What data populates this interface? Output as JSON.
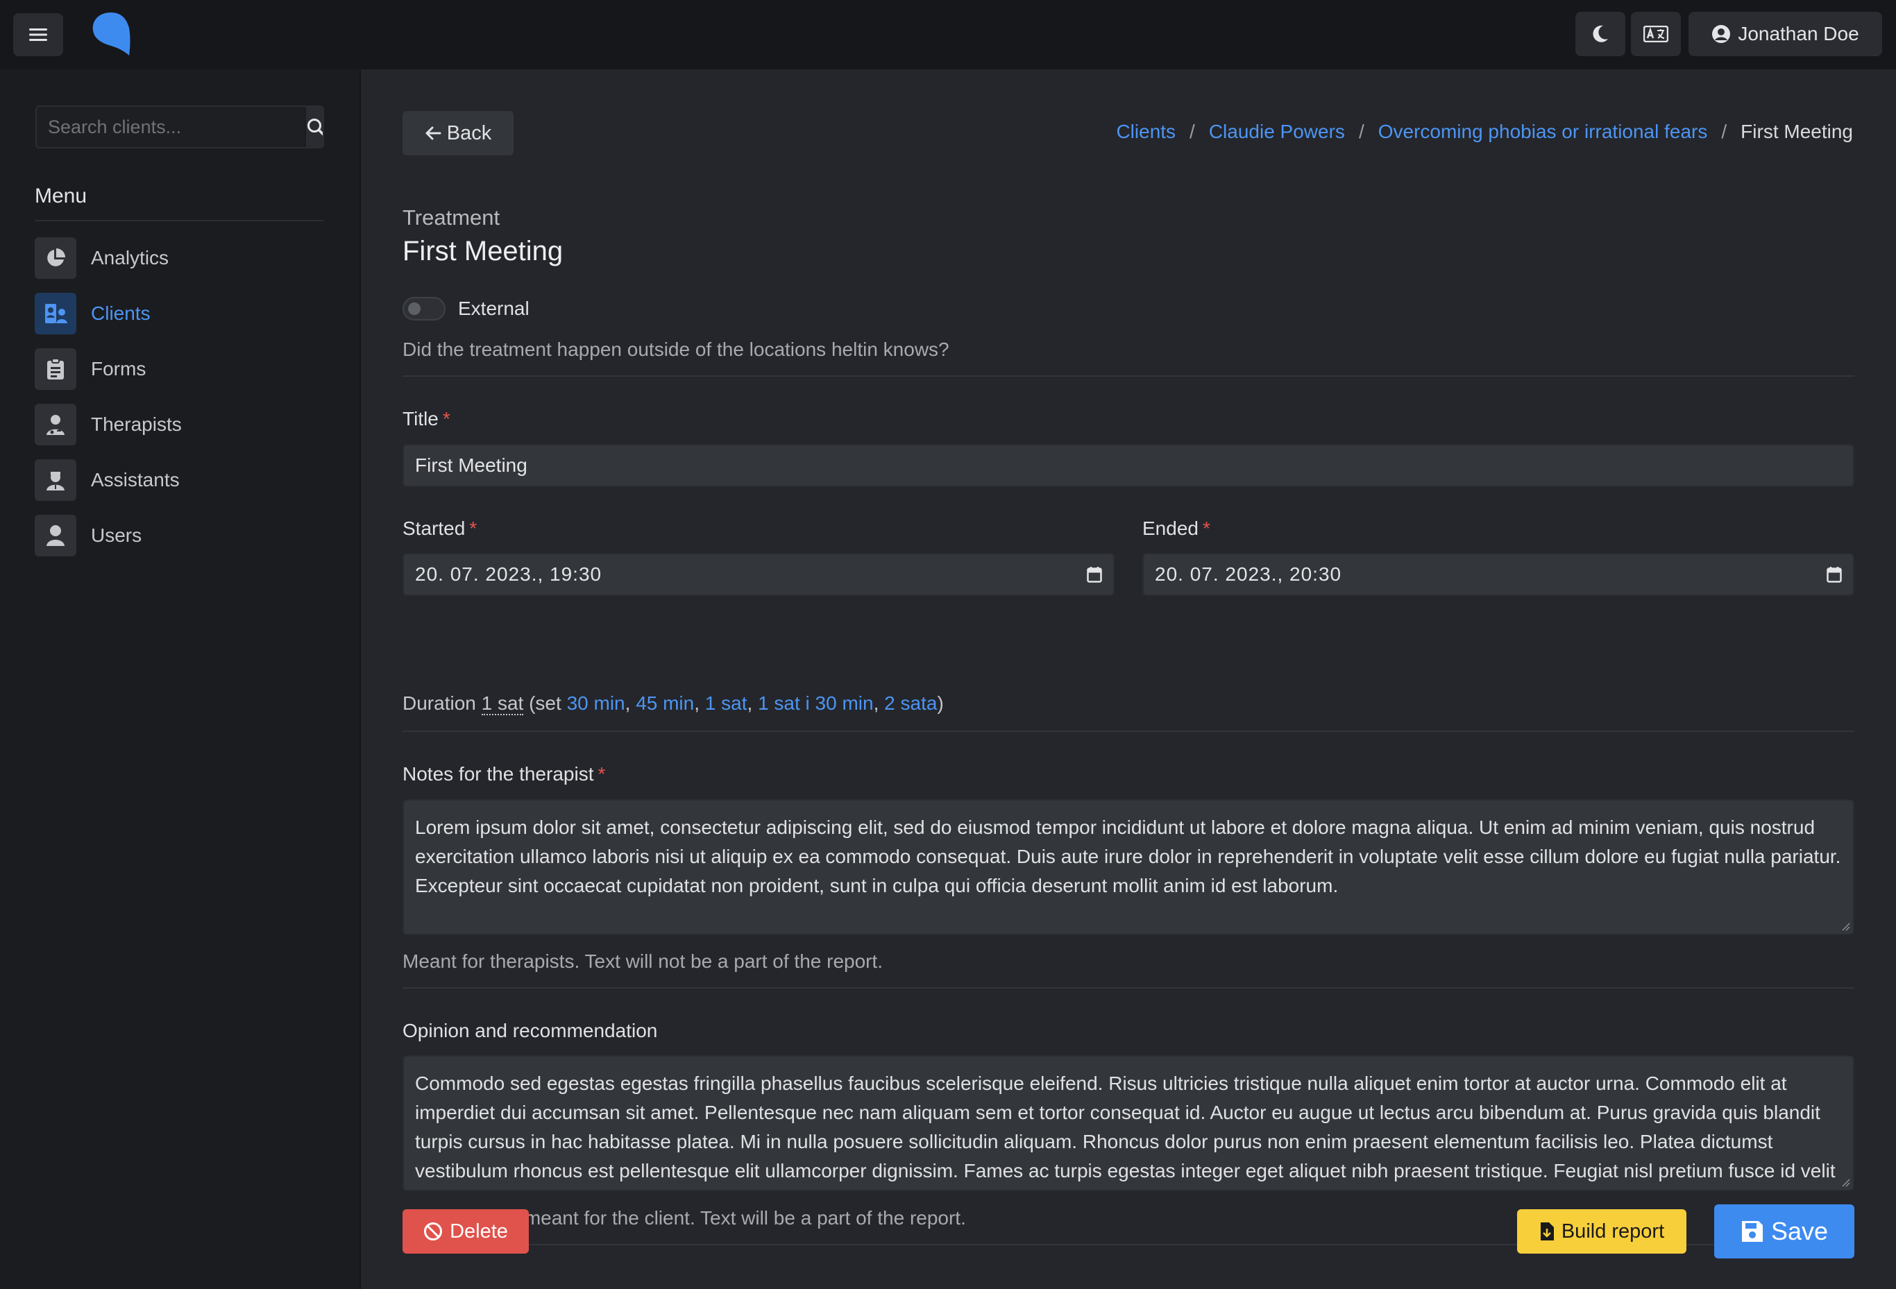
{
  "header": {
    "user_name": "Jonathan Doe"
  },
  "sidebar": {
    "search_placeholder": "Search clients...",
    "menu_title": "Menu",
    "items": [
      {
        "label": "Analytics",
        "icon": "chart-pie-icon"
      },
      {
        "label": "Clients",
        "icon": "clients-icon",
        "active": true
      },
      {
        "label": "Forms",
        "icon": "clipboard-icon"
      },
      {
        "label": "Therapists",
        "icon": "therapist-icon"
      },
      {
        "label": "Assistants",
        "icon": "assistant-icon"
      },
      {
        "label": "Users",
        "icon": "user-icon"
      }
    ]
  },
  "main": {
    "back_label": "Back",
    "breadcrumb": {
      "clients": "Clients",
      "client": "Claudie Powers",
      "treatment_plan": "Overcoming phobias or irrational fears",
      "current": "First Meeting",
      "separator": "/"
    },
    "eyebrow": "Treatment",
    "title": "First Meeting",
    "external": {
      "label": "External",
      "checked": false,
      "help": "Did the treatment happen outside of the locations heltin knows?"
    },
    "title_field": {
      "label": "Title",
      "required_mark": "*",
      "value": "First Meeting"
    },
    "started": {
      "label": "Started",
      "required_mark": "*",
      "value": "20. 07. 2023., 19:30"
    },
    "ended": {
      "label": "Ended",
      "required_mark": "*",
      "value": "20. 07. 2023., 20:30"
    },
    "duration": {
      "label": "Duration",
      "value": "1 sat",
      "set_prefix": "(set",
      "options": [
        "30 min",
        "45 min",
        "1 sat",
        "1 sat i 30 min",
        "2 sata"
      ],
      "close": ")"
    },
    "notes": {
      "label": "Notes for the therapist",
      "required_mark": "*",
      "value": "Lorem ipsum dolor sit amet, consectetur adipiscing elit, sed do eiusmod tempor incididunt ut labore et dolore magna aliqua. Ut enim ad minim veniam, quis nostrud exercitation ullamco laboris nisi ut aliquip ex ea commodo consequat. Duis aute irure dolor in reprehenderit in voluptate velit esse cillum dolore eu fugiat nulla pariatur. Excepteur sint occaecat cupidatat non proident, sunt in culpa qui officia deserunt mollit anim id est laborum.",
      "help": "Meant for therapists. Text will not be a part of the report."
    },
    "opinion": {
      "label": "Opinion and recommendation",
      "value": "Commodo sed egestas egestas fringilla phasellus faucibus scelerisque eleifend. Risus ultricies tristique nulla aliquet enim tortor at auctor urna. Commodo elit at imperdiet dui accumsan sit amet. Pellentesque nec nam aliquam sem et tortor consequat id. Auctor eu augue ut lectus arcu bibendum at. Purus gravida quis blandit turpis cursus in hac habitasse platea. Mi in nulla posuere sollicitudin aliquam. Rhoncus dolor purus non enim praesent elementum facilisis leo. Platea dictumst vestibulum rhoncus est pellentesque elit ullamcorper dignissim. Fames ac turpis egestas integer eget aliquet nibh praesent tristique. Feugiat nisl pretium fusce id velit ut tortor pretium viverra suspendisse potenti nullam.",
      "help": "Description is meant for the client. Text will be a part of the report."
    },
    "actions": {
      "delete": "Delete",
      "build_report": "Build report",
      "save": "Save"
    }
  },
  "colors": {
    "accent": "#4d95f3",
    "danger": "#e0524c",
    "warning": "#f7cf3b",
    "primary": "#3e8bf0"
  }
}
